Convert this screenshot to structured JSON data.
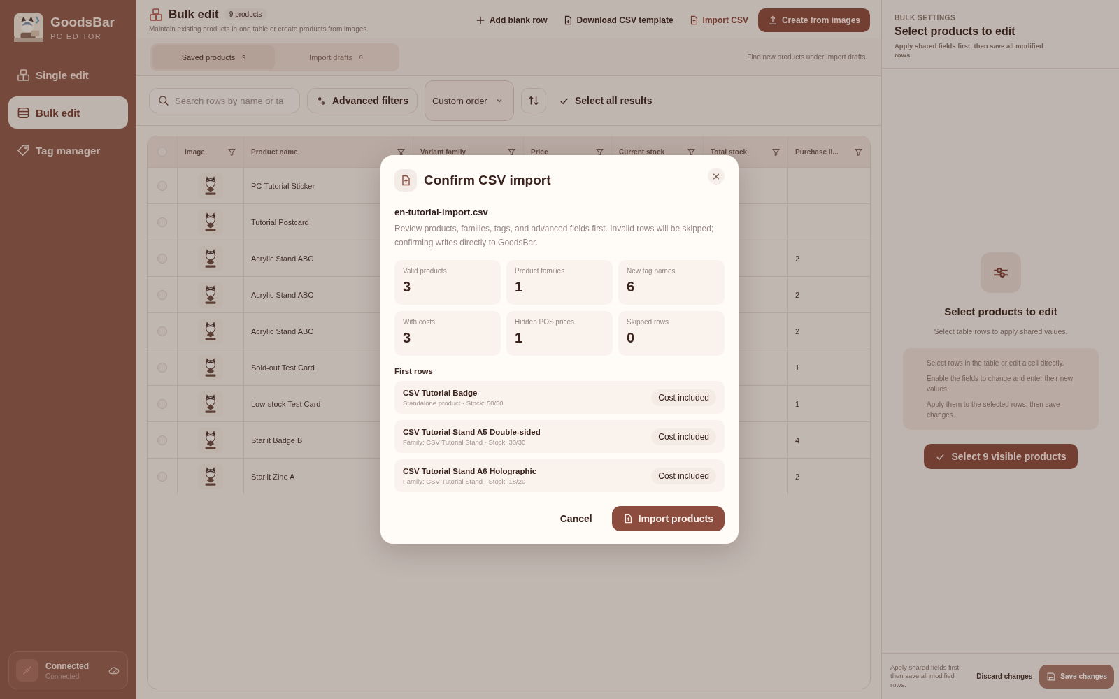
{
  "app": {
    "name": "GoodsBar",
    "subtitle": "PC EDITOR"
  },
  "nav": [
    {
      "label": "Single edit",
      "kind": "single",
      "selected": false
    },
    {
      "label": "Bulk edit",
      "kind": "bulk",
      "selected": true
    },
    {
      "label": "Tag manager",
      "kind": "tag",
      "selected": false
    }
  ],
  "connection": {
    "title": "Connected",
    "status": "Connected"
  },
  "header": {
    "title": "Bulk edit",
    "count": "9 products",
    "subtitle": "Maintain existing products in one table or create products from images.",
    "actions": [
      {
        "label": "Add blank row",
        "kind": "add"
      },
      {
        "label": "Download CSV template",
        "kind": "download"
      },
      {
        "label": "Import CSV",
        "kind": "import"
      },
      {
        "label": "Create from images",
        "kind": "primary"
      }
    ]
  },
  "tabs": [
    {
      "label": "Saved products",
      "count": "9",
      "selected": true
    },
    {
      "label": "Import drafts",
      "count": "0",
      "selected": false
    }
  ],
  "tabs_hint": "Find new products under Import drafts.",
  "toolbar": {
    "search_placeholder": "Search rows by name or ta",
    "filters": "Advanced filters",
    "sort": "Custom order",
    "select_all": "Select all results"
  },
  "table": {
    "all_selected": false,
    "columns": [
      "Image",
      "Product name",
      "Variant family",
      "Price",
      "Current stock",
      "Total stock",
      "Purchase li..."
    ],
    "rows": [
      {
        "name": "PC Tutorial Sticker",
        "selected": false
      },
      {
        "name": "Tutorial Postcard",
        "selected": false
      },
      {
        "name": "Acrylic Stand ABC",
        "purchase_limit": "2",
        "selected": false
      },
      {
        "name": "Acrylic Stand ABC",
        "purchase_limit": "2",
        "selected": false
      },
      {
        "name": "Acrylic Stand ABC",
        "purchase_limit": "2",
        "selected": false
      },
      {
        "name": "Sold-out Test Card",
        "purchase_limit": "1",
        "selected": false
      },
      {
        "name": "Low-stock Test Card",
        "purchase_limit": "1",
        "selected": false
      },
      {
        "name": "Starlit Badge B",
        "purchase_limit": "4",
        "selected": false
      },
      {
        "name": "Starlit Zine A",
        "purchase_limit": "2",
        "selected": false
      }
    ]
  },
  "bulk_settings": {
    "eyebrow": "BULK SETTINGS",
    "title": "Select products to edit",
    "subtitle": "Apply shared fields first, then save all modified rows.",
    "empty_title": "Select products to edit",
    "empty_text": "Select table rows to apply shared values.",
    "steps": [
      "Select rows in the table or edit a cell directly.",
      "Enable the fields to change and enter their new values.",
      "Apply them to the selected rows, then save changes."
    ],
    "button": "Select 9 visible products"
  },
  "footer": {
    "hint": "Apply shared fields first, then save all modified rows.",
    "discard": "Discard changes",
    "save": "Save changes"
  },
  "dialog": {
    "title": "Confirm CSV import",
    "filename": "en-tutorial-import.csv",
    "description": "Review products, families, tags, and advanced fields first. Invalid rows will be skipped; confirming writes directly to GoodsBar.",
    "stats": [
      {
        "label": "Valid products",
        "value": "3"
      },
      {
        "label": "Product families",
        "value": "1"
      },
      {
        "label": "New tag names",
        "value": "6"
      },
      {
        "label": "With costs",
        "value": "3"
      },
      {
        "label": "Hidden POS prices",
        "value": "1"
      },
      {
        "label": "Skipped rows",
        "value": "0"
      }
    ],
    "rows_heading": "First rows",
    "rows": [
      {
        "name": "CSV Tutorial Badge",
        "detail": "Standalone product · Stock: 50/50",
        "badge": "Cost included"
      },
      {
        "name": "CSV Tutorial Stand A5 Double-sided",
        "detail": "Family: CSV Tutorial Stand · Stock: 30/30",
        "badge": "Cost included"
      },
      {
        "name": "CSV Tutorial Stand A6 Holographic",
        "detail": "Family: CSV Tutorial Stand · Stock: 18/20",
        "badge": "Cost included"
      }
    ],
    "cancel": "Cancel",
    "confirm": "Import products"
  }
}
